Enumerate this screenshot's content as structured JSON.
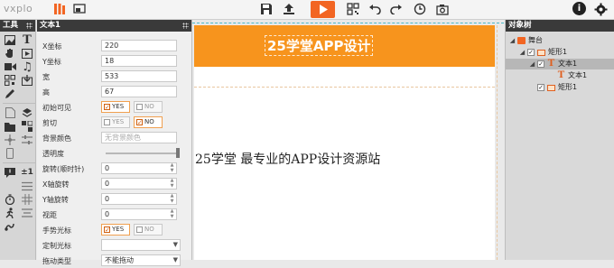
{
  "app": {
    "logo": "vxplo",
    "accent": "#f26522",
    "brand_banner_color": "#f7941d"
  },
  "toolbar": {
    "icons": [
      "library-icon",
      "preview-window-icon",
      "save-icon",
      "publish-icon",
      "play-icon",
      "qrcode-icon",
      "undo-icon",
      "redo-icon",
      "history-icon",
      "screenshot-icon",
      "info-icon",
      "settings-icon"
    ]
  },
  "tools": {
    "title": "工具",
    "text_tool": "T",
    "counter_tool": "±1"
  },
  "props": {
    "title": "文本1",
    "fields": {
      "x_label": "X坐标",
      "x_value": "220",
      "y_label": "Y坐标",
      "y_value": "18",
      "w_label": "宽",
      "w_value": "533",
      "h_label": "高",
      "h_value": "67",
      "init_visible_label": "初始可见",
      "init_visible_yes": "YES",
      "init_visible_no": "NO",
      "clip_label": "剪切",
      "clip_yes": "YES",
      "clip_no": "NO",
      "bg_color_label": "背景颜色",
      "bg_color_placeholder": "无背景颜色",
      "opacity_label": "透明度",
      "rotate_label": "旋转(顺时针)",
      "rotate_value": "0",
      "xrot_label": "X轴旋转",
      "xrot_value": "0",
      "yrot_label": "Y轴旋转",
      "yrot_value": "0",
      "perspective_label": "视距",
      "perspective_value": "0",
      "hand_cursor_label": "手势光标",
      "hand_cursor_yes": "YES",
      "hand_cursor_no": "NO",
      "custom_cursor_label": "定制光标",
      "custom_cursor_value": "",
      "drag_type_label": "拖动类型",
      "drag_type_value": "不能拖动"
    },
    "opacity_percent": 100
  },
  "canvas": {
    "banner_title": "25学堂APP设计",
    "main_text": "25学堂    最专业的APP设计资源站"
  },
  "objects": {
    "title": "对象树",
    "items": {
      "stage": "舞台",
      "shape1": "矩形1",
      "text1": "文本1",
      "text1_child": "文本1",
      "shape1b": "矩形1"
    }
  }
}
